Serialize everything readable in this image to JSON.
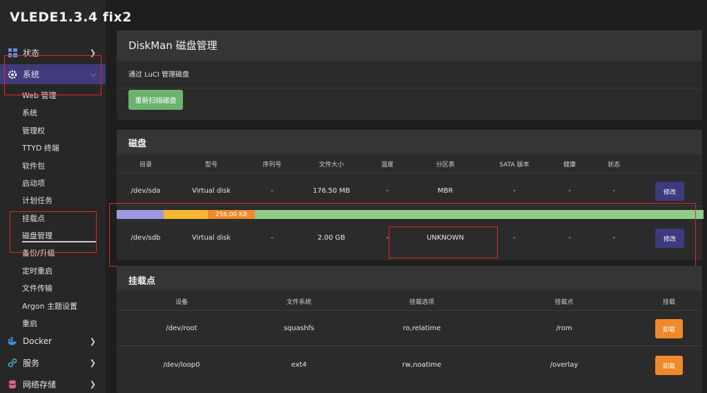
{
  "brand": "VLEDE1.3.4 fix2",
  "sidebar": {
    "top_items": [
      {
        "label": "状态",
        "icon": "dashboard-icon"
      },
      {
        "label": "系统",
        "icon": "gear-icon"
      }
    ],
    "sub_items": [
      "Web 管理",
      "系统",
      "管理权",
      "TTYD 终端",
      "软件包",
      "启动项",
      "计划任务",
      "挂载点",
      "磁盘管理",
      "备份/升级",
      "定时重启",
      "文件传输",
      "Argon 主题设置",
      "重启"
    ],
    "bottom_items": [
      {
        "label": "Docker",
        "icon": "docker-icon"
      },
      {
        "label": "服务",
        "icon": "services-icon"
      },
      {
        "label": "网络存储",
        "icon": "storage-icon"
      }
    ]
  },
  "page": {
    "title": "DiskMan 磁盘管理",
    "description": "通过 LuCI 管理磁盘",
    "rescan_label": "重新扫描磁盘"
  },
  "disks": {
    "title": "磁盘",
    "headers": [
      "目录",
      "型号",
      "序列号",
      "文件大小",
      "温度",
      "分区表",
      "SATA 版本",
      "健康",
      "状态"
    ],
    "rows": [
      {
        "path": "/dev/sda",
        "model": "Virtual disk",
        "serial": "-",
        "size": "176.50 MB",
        "temp": "-",
        "table": "MBR",
        "sata": "-",
        "health": "-",
        "status": "-",
        "action": "修改"
      },
      {
        "path": "/dev/sdb",
        "model": "Virtual disk",
        "serial": "-",
        "size": "2.00 GB",
        "temp": "-",
        "table": "UNKNOWN",
        "sata": "-",
        "health": "-",
        "status": "-",
        "action": "修改"
      }
    ],
    "partitions": [
      {
        "label": "",
        "color": "#9d97e0"
      },
      {
        "label": "",
        "color": "#f4b731"
      },
      {
        "label": "256.00 KB",
        "color": "#f0892a"
      },
      {
        "label": "",
        "color": "#8fce86"
      }
    ]
  },
  "mounts": {
    "title": "挂载点",
    "headers": [
      "设备",
      "文件系统",
      "挂载选项",
      "挂载点",
      "挂载"
    ],
    "rows": [
      {
        "device": "/dev/root",
        "fs": "squashfs",
        "options": "ro,relatime",
        "point": "/rom",
        "action": "卸载"
      },
      {
        "device": "/dev/loop0",
        "fs": "ext4",
        "options": "rw,noatime",
        "point": "/overlay",
        "action": "卸载"
      }
    ]
  },
  "colors": {
    "accent": "#413a7b",
    "green": "#6cb370",
    "orange": "#f0892a",
    "highlight": "#e22a2a"
  }
}
